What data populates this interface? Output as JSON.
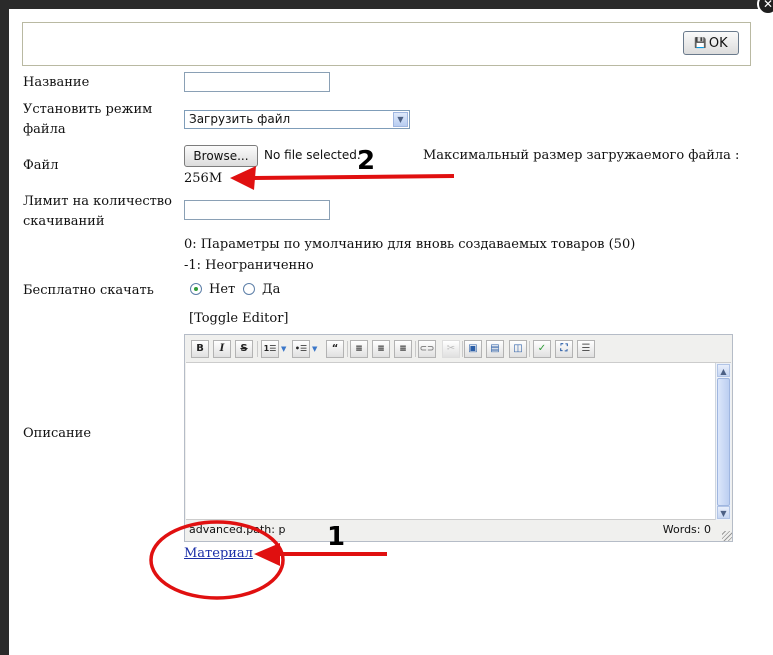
{
  "toolbar": {
    "ok_label": "OK",
    "ok_icon": "floppy-disk-icon"
  },
  "form": {
    "name_label": "Название",
    "name_value": "",
    "mode_label": "Установить режим файла",
    "mode_selected": "Загрузить файл",
    "file_label": "Файл",
    "browse_label": "Browse...",
    "file_status": "No file selected.",
    "max_size_label": "Максимальный размер загружаемого файла :",
    "max_size_value": "256M",
    "limit_label": "Лимит на количество скачиваний",
    "limit_value": "",
    "limit_hint_1": "0: Параметры по умолчанию для вновь создаваемых товаров (50)",
    "limit_hint_2": "-1: Неограниченно",
    "free_label": "Бесплатно скачать",
    "free_options": [
      {
        "label": "Нет",
        "checked": true
      },
      {
        "label": "Да",
        "checked": false
      }
    ],
    "toggle_editor": "[Toggle Editor]",
    "description_label": "Описание",
    "material_link": "Материал"
  },
  "editor": {
    "toolbar_buttons": [
      "bold",
      "italic",
      "strikethrough",
      "ordered-list",
      "unordered-list",
      "blockquote",
      "align-left",
      "align-center",
      "align-right",
      "link",
      "unlink",
      "image",
      "horizontal-rule",
      "insert-block",
      "spellcheck",
      "fullscreen",
      "page-break"
    ],
    "content": "",
    "path": "advanced.path: p",
    "words": "Words: 0"
  },
  "annotations": {
    "marker_1": "1",
    "marker_2": "2",
    "color": "#e01010"
  }
}
